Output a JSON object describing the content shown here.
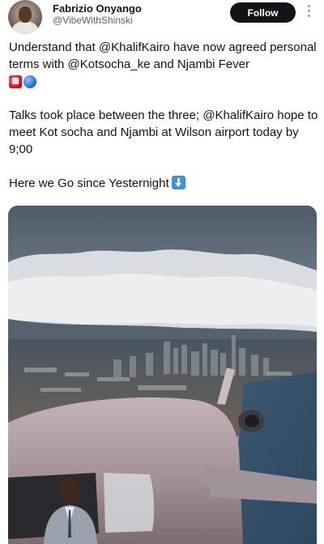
{
  "author": {
    "name": "Fabrizio Onyango",
    "handle": "@VibeWithShinski"
  },
  "actions": {
    "follow_label": "Follow"
  },
  "tweet": {
    "line1": "Understand that @KhalifKairo have now agreed personal terms with @Kotsocha_ke and Njambi Fever",
    "emoji_after_line1": [
      "police-light-emoji",
      "blue-circle-emoji"
    ],
    "line2": "Talks took place between the three; @KhalifKairo hope to meet Kot socha and Njambi at Wilson airport today by 9;00",
    "line3": "Here we Go since Yesternight",
    "emoji_after_line3": "down-arrow-emoji"
  },
  "media": {
    "kind": "photo",
    "icon": "photo-of-airplane-over-city"
  }
}
